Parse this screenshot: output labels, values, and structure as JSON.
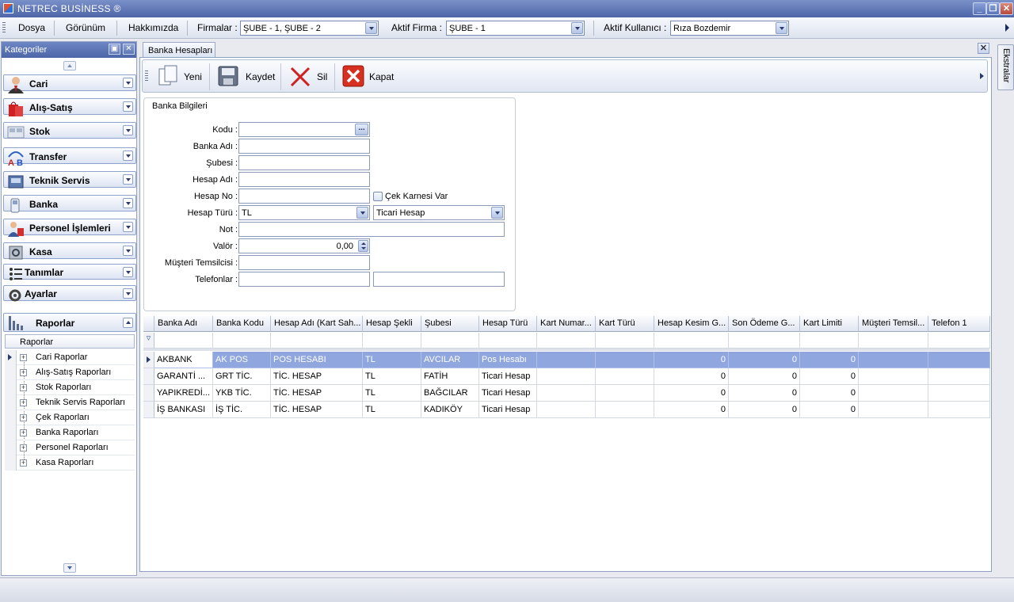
{
  "window": {
    "title": "NETREC BUSİNESS ®",
    "minimize": "_",
    "restore": "❐",
    "close": "✕"
  },
  "menu": {
    "file": "Dosya",
    "view": "Görünüm",
    "about": "Hakkımızda",
    "firms_label": "Firmalar :",
    "firms_value": "ŞUBE - 1, ŞUBE - 2",
    "active_firm_label": "Aktif Firma :",
    "active_firm_value": "ŞUBE - 1",
    "active_user_label": "Aktif Kullanıcı :",
    "active_user_value": "Rıza Bozdemir"
  },
  "right_strip": {
    "label": "Ekstralar"
  },
  "sidebar": {
    "title": "Kategoriler",
    "pin": "▣",
    "close": "✕",
    "categories": [
      {
        "label": "Cari",
        "icon": "person-icon"
      },
      {
        "label": "Alış-Satış",
        "icon": "shopping-bag-icon"
      },
      {
        "label": "Stok",
        "icon": "boxes-icon"
      },
      {
        "label": "Transfer",
        "icon": "transfer-icon"
      },
      {
        "label": "Teknik Servis",
        "icon": "service-icon"
      },
      {
        "label": "Banka",
        "icon": "bank-icon"
      },
      {
        "label": "Personel İşlemleri",
        "icon": "personnel-icon"
      },
      {
        "label": "Kasa",
        "icon": "safe-icon"
      },
      {
        "label": "Tanımlar",
        "icon": "list-icon"
      },
      {
        "label": "Ayarlar",
        "icon": "settings-icon"
      },
      {
        "label": "Raporlar",
        "icon": "reports-icon"
      }
    ],
    "tree_header": "Raporlar",
    "tree_items": [
      "Cari Raporlar",
      "Alış-Satış Raporları",
      "Stok Raporları",
      "Teknik Servis Raporları",
      "Çek Raporları",
      "Banka Raporları",
      "Personel Raporları",
      "Kasa Raporları"
    ]
  },
  "tab": {
    "label": "Banka Hesapları",
    "close": "✕"
  },
  "toolbar": {
    "new": "Yeni",
    "save": "Kaydet",
    "delete": "Sil",
    "close": "Kapat"
  },
  "form": {
    "group_title": "Banka Bilgileri",
    "code_label": "Kodu :",
    "code_value": "",
    "ellipsis": "...",
    "bank_name_label": "Banka Adı :",
    "bank_name_value": "",
    "branch_label": "Şubesi :",
    "branch_value": "",
    "account_name_label": "Hesap Adı :",
    "account_name_value": "",
    "account_no_label": "Hesap No :",
    "account_no_value": "",
    "checkbook_label": "Çek Karnesi Var",
    "account_type_label": "Hesap Türü :",
    "currency_value": "TL",
    "account_type_value": "Ticari Hesap",
    "note_label": "Not :",
    "note_value": "",
    "valor_label": "Valör :",
    "valor_value": "0,00",
    "rep_label": "Müşteri Temsilcisi :",
    "rep_value": "",
    "phones_label": "Telefonlar :",
    "phone1_value": "",
    "phone2_value": ""
  },
  "grid": {
    "filter_icon": "▿",
    "columns": [
      "Banka Adı",
      "Banka Kodu",
      "Hesap Adı (Kart Sah...",
      "Hesap Şekli",
      "Şubesi",
      "Hesap Türü",
      "Kart Numar...",
      "Kart Türü",
      "Hesap Kesim G...",
      "Son Ödeme G...",
      "Kart Limiti",
      "Müşteri Temsil...",
      "Telefon 1"
    ],
    "rows": [
      [
        "AKBANK",
        "AK POS",
        "POS HESABI",
        "TL",
        "AVCILAR",
        "Pos Hesabı",
        "",
        "",
        "0",
        "0",
        "0",
        "",
        ""
      ],
      [
        "GARANTİ ...",
        "GRT TİC.",
        "TİC. HESAP",
        "TL",
        "FATİH",
        "Ticari Hesap",
        "",
        "",
        "0",
        "0",
        "0",
        "",
        ""
      ],
      [
        "YAPIKREDİ...",
        "YKB TİC.",
        "TİC. HESAP",
        "TL",
        "BAĞCILAR",
        "Ticari Hesap",
        "",
        "",
        "0",
        "0",
        "0",
        "",
        ""
      ],
      [
        "İŞ BANKASI",
        "İŞ TİC.",
        "TİC. HESAP",
        "TL",
        "KADIKÖY",
        "Ticari Hesap",
        "",
        "",
        "0",
        "0",
        "0",
        "",
        ""
      ]
    ]
  },
  "colors": {
    "accent": "#5a72b4",
    "selection": "#8fa6de",
    "titlebar": "#6a82c0"
  }
}
